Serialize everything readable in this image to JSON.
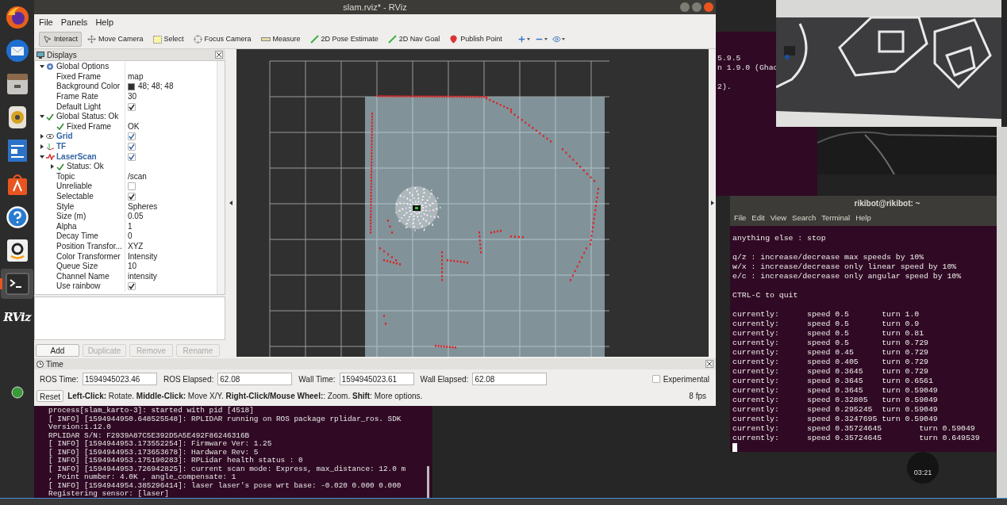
{
  "dock": {
    "items": [
      {
        "kind": "browser",
        "selected": false
      },
      {
        "kind": "mail",
        "selected": false
      },
      {
        "kind": "files",
        "selected": false
      },
      {
        "kind": "music",
        "selected": false
      },
      {
        "kind": "writer",
        "selected": false
      },
      {
        "kind": "store",
        "selected": false
      },
      {
        "kind": "help",
        "selected": false
      },
      {
        "kind": "amazon",
        "selected": false
      },
      {
        "kind": "terminal",
        "selected": true
      },
      {
        "kind": "logo",
        "label": "RViz",
        "selected": false
      }
    ]
  },
  "rviz": {
    "title": "slam.rviz* - RViz",
    "menu": [
      "File",
      "Panels",
      "Help"
    ],
    "toolbar": {
      "tools": [
        {
          "kind": "interact",
          "label": "Interact",
          "selected": true
        },
        {
          "kind": "move_camera",
          "label": "Move Camera",
          "selected": false
        },
        {
          "kind": "select",
          "label": "Select",
          "selected": false
        },
        {
          "kind": "focus_camera",
          "label": "Focus Camera",
          "selected": false
        },
        {
          "kind": "measure",
          "label": "Measure",
          "selected": false
        },
        {
          "kind": "pose_estimate",
          "label": "2D Pose Estimate",
          "selected": false
        },
        {
          "kind": "nav_goal",
          "label": "2D Nav Goal",
          "selected": false
        },
        {
          "kind": "publish_point",
          "label": "Publish Point",
          "selected": false
        }
      ],
      "view_buttons": [
        {
          "kind": "add"
        },
        {
          "kind": "remove"
        },
        {
          "kind": "eye"
        }
      ]
    },
    "displays": {
      "title": "Displays",
      "tree": [
        {
          "kind": "options",
          "label": "Global Options",
          "expanded": true,
          "children": [
            {
              "kind": "property",
              "label": "Fixed Frame",
              "value": "map"
            },
            {
              "kind": "property",
              "label": "Background Color",
              "value": "48; 48; 48",
              "color": "#303030"
            },
            {
              "kind": "property",
              "label": "Frame Rate",
              "value": "30"
            },
            {
              "kind": "property",
              "label": "Default Light",
              "checked": true
            }
          ]
        },
        {
          "kind": "status",
          "label": "Global Status: Ok",
          "expanded": true,
          "children": [
            {
              "kind": "status",
              "label": "Fixed Frame",
              "value": "OK"
            }
          ]
        },
        {
          "kind": "grid_display",
          "label": "Grid",
          "expanded": false,
          "checked": true
        },
        {
          "kind": "tf_display",
          "label": "TF",
          "expanded": false,
          "checked": true
        },
        {
          "kind": "laser_display",
          "label": "LaserScan",
          "expanded": true,
          "checked": true,
          "children": [
            {
              "kind": "status",
              "label": "Status: Ok",
              "expanded": false
            },
            {
              "kind": "property",
              "label": "Topic",
              "value": "/scan"
            },
            {
              "kind": "property",
              "label": "Unreliable",
              "checked": false
            },
            {
              "kind": "property",
              "label": "Selectable",
              "checked": true
            },
            {
              "kind": "property",
              "label": "Style",
              "value": "Spheres"
            },
            {
              "kind": "property",
              "label": "Size (m)",
              "value": "0.05"
            },
            {
              "kind": "property",
              "label": "Alpha",
              "value": "1"
            },
            {
              "kind": "property",
              "label": "Decay Time",
              "value": "0"
            },
            {
              "kind": "property",
              "label": "Position Transfor...",
              "value": "XYZ"
            },
            {
              "kind": "property",
              "label": "Color Transformer",
              "value": "Intensity"
            },
            {
              "kind": "property",
              "label": "Queue Size",
              "value": "10"
            },
            {
              "kind": "property",
              "label": "Channel Name",
              "value": "intensity"
            },
            {
              "kind": "property",
              "label": "Use rainbow",
              "checked": true
            }
          ]
        }
      ],
      "buttons": [
        {
          "label": "Add",
          "disabled": false
        },
        {
          "label": "Duplicate",
          "disabled": true
        },
        {
          "label": "Remove",
          "disabled": true
        },
        {
          "label": "Rename",
          "disabled": true
        }
      ]
    },
    "time": {
      "title": "Time",
      "fields": [
        {
          "label": "ROS Time:",
          "value": "1594945023.46"
        },
        {
          "label": "ROS Elapsed:",
          "value": "62.08"
        },
        {
          "label": "Wall Time:",
          "value": "1594945023.61"
        },
        {
          "label": "Wall Elapsed:",
          "value": "62.08"
        }
      ],
      "experimental": {
        "label": "Experimental",
        "checked": false
      },
      "reset": "Reset",
      "hint": "**Left-Click:** Rotate. **Middle-Click:** Move X/Y. **Right-Click/Mouse Wheel:**: Zoom. **Shift**: More options.",
      "fps": "8 fps"
    }
  },
  "launch_terminal": {
    "lines": [
      "process[slam_karto-3]: started with pid [4518]",
      "[ INFO] [1594944950.648525548]: RPLIDAR running on ROS package rplidar_ros. SDK",
      "Version:1.12.0",
      "RPLIDAR S/N: F2939A87C5E392D5A5E492F86246316B",
      "[ INFO] [1594944953.173552254]: Firmware Ver: 1.25",
      "[ INFO] [1594944953.173653678]: Hardware Rev: 5",
      "[ INFO] [1594944953.175190283]: RPLidar health status : 0",
      "[ INFO] [1594944953.726942825]: current scan mode: Express, max_distance: 12.0 m",
      ", Point number: 4.0K , angle_compensate: 1",
      "[ INFO] [1594944954.385296414]: laser laser's pose wrt base: -0.020 0.000 0.000",
      "Registering sensor: [laser]"
    ]
  },
  "background_terminal": {
    "blocks": [
      [
        "5.9.5",
        "n 1.9.0 (Ghac"
      ],
      [
        "2)."
      ]
    ]
  },
  "teleop_terminal": {
    "title": "rikibot@rikibot: ~",
    "menu": [
      "File",
      "Edit",
      "View",
      "Search",
      "Terminal",
      "Help"
    ],
    "blocks": [
      [
        "anything else : stop"
      ],
      [
        "q/z : increase/decrease max speeds by 10%",
        "w/x : increase/decrease only linear speed by 10%",
        "e/c : increase/decrease only angular speed by 10%"
      ],
      [
        "CTRL-C to quit"
      ],
      [
        "currently:\tspeed 0.5\tturn 1.0",
        "currently:\tspeed 0.5\tturn 0.9",
        "currently:\tspeed 0.5\tturn 0.81",
        "currently:\tspeed 0.5\tturn 0.729",
        "currently:\tspeed 0.45\tturn 0.729",
        "currently:\tspeed 0.405\tturn 0.729",
        "currently:\tspeed 0.3645\tturn 0.729",
        "currently:\tspeed 0.3645\tturn 0.6561",
        "currently:\tspeed 0.3645\tturn 0.59049",
        "currently:\tspeed 0.32805\tturn 0.59049",
        "currently:\tspeed 0.295245\tturn 0.59049",
        "currently:\tspeed 0.3247695\tturn 0.59049",
        "currently:\tspeed 0.35724645\tturn 0.59049",
        "currently:\tspeed 0.35724645\tturn 0.649539"
      ]
    ]
  },
  "recorder": {
    "time": "03:21"
  }
}
